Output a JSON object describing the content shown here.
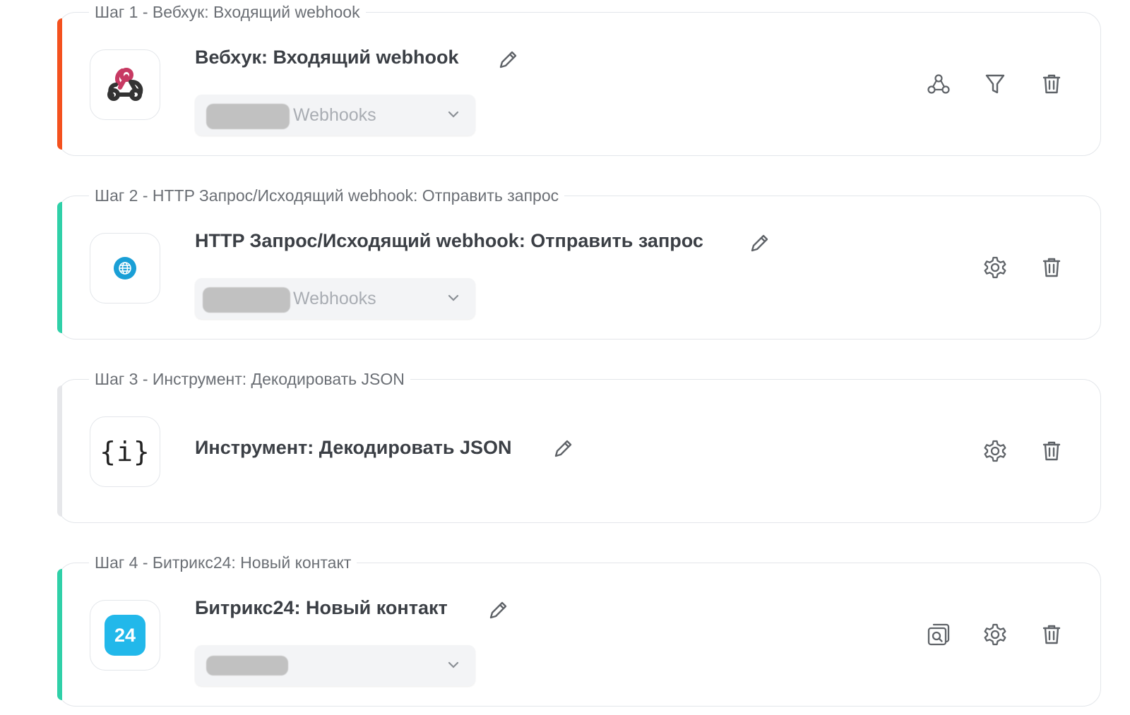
{
  "steps": [
    {
      "legend": "Шаг 1 - Вебхук: Входящий webhook",
      "title": "Вебхук: Входящий webhook",
      "icon": "webhook-icon",
      "accent": "#f4511e",
      "select": {
        "value": "Webhooks"
      },
      "actions": [
        "webhook-icon",
        "filter-icon",
        "trash-icon"
      ]
    },
    {
      "legend": "Шаг 2 - HTTP Запрос/Исходящий webhook: Отправить запрос",
      "title": "HTTP Запрос/Исходящий webhook: Отправить запрос",
      "icon": "globe-icon",
      "accent": "#2fd0a8",
      "select": {
        "value": "Webhooks"
      },
      "actions": [
        "gear-icon",
        "trash-icon"
      ]
    },
    {
      "legend": "Шаг 3 - Инструмент: Декодировать JSON",
      "title": "Инструмент: Декодировать JSON",
      "icon": "json-icon",
      "icon_text": "{i}",
      "accent": "#e6e7ea",
      "actions": [
        "gear-icon",
        "trash-icon"
      ]
    },
    {
      "legend": "Шаг 4 - Битрикс24: Новый контакт",
      "title": "Битрикс24: Новый контакт",
      "icon": "bitrix24-icon",
      "icon_text": "24",
      "accent": "#2fd0a8",
      "select": {
        "value": ""
      },
      "actions": [
        "search-doc-icon",
        "gear-icon",
        "trash-icon"
      ]
    }
  ]
}
